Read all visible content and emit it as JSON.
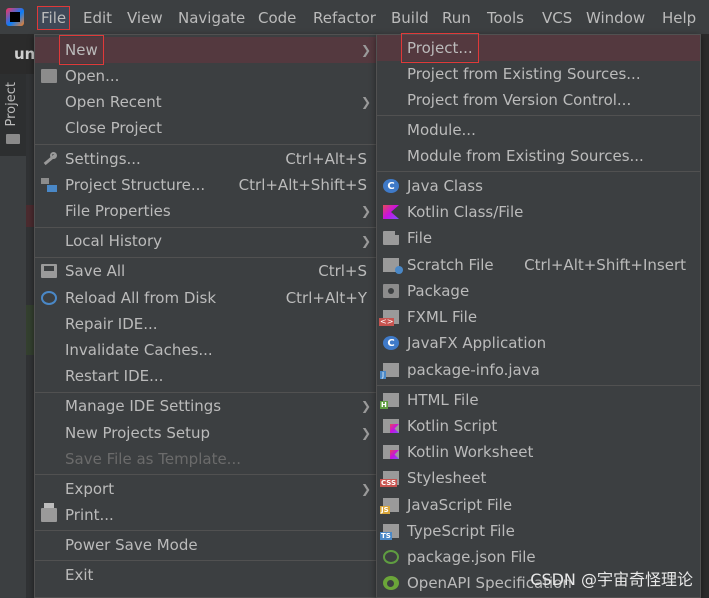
{
  "menubar": {
    "items": [
      "File",
      "Edit",
      "View",
      "Navigate",
      "Code",
      "Refactor",
      "Build",
      "Run",
      "Tools",
      "VCS",
      "Window",
      "Help"
    ]
  },
  "background": {
    "title": "unt",
    "project_tab": "Project"
  },
  "file_menu": {
    "items": [
      {
        "label": "New",
        "arrow": true,
        "selected": true
      },
      {
        "label": "Open...",
        "icon": "folder-icon"
      },
      {
        "label": "Open Recent",
        "arrow": true
      },
      {
        "label": "Close Project"
      },
      {
        "label": "Settings...",
        "shortcut": "Ctrl+Alt+S",
        "icon": "wrench-icon"
      },
      {
        "label": "Project Structure...",
        "shortcut": "Ctrl+Alt+Shift+S",
        "icon": "project-structure-icon"
      },
      {
        "label": "File Properties",
        "arrow": true
      },
      {
        "label": "Local History",
        "arrow": true
      },
      {
        "label": "Save All",
        "shortcut": "Ctrl+S",
        "icon": "save-icon"
      },
      {
        "label": "Reload All from Disk",
        "shortcut": "Ctrl+Alt+Y",
        "icon": "reload-icon"
      },
      {
        "label": "Repair IDE..."
      },
      {
        "label": "Invalidate Caches..."
      },
      {
        "label": "Restart IDE..."
      },
      {
        "label": "Manage IDE Settings",
        "arrow": true
      },
      {
        "label": "New Projects Setup",
        "arrow": true
      },
      {
        "label": "Save File as Template...",
        "disabled": true
      },
      {
        "label": "Export",
        "arrow": true
      },
      {
        "label": "Print...",
        "icon": "printer-icon"
      },
      {
        "label": "Power Save Mode"
      },
      {
        "label": "Exit"
      }
    ]
  },
  "new_menu": {
    "items": [
      {
        "label": "Project...",
        "selected": true
      },
      {
        "label": "Project from Existing Sources..."
      },
      {
        "label": "Project from Version Control..."
      },
      {
        "label": "Module..."
      },
      {
        "label": "Module from Existing Sources..."
      },
      {
        "label": "Java Class",
        "icon": "java-class-icon"
      },
      {
        "label": "Kotlin Class/File",
        "icon": "kotlin-icon"
      },
      {
        "label": "File",
        "icon": "file-icon"
      },
      {
        "label": "Scratch File",
        "shortcut": "Ctrl+Alt+Shift+Insert",
        "icon": "scratch-file-icon"
      },
      {
        "label": "Package",
        "icon": "package-icon"
      },
      {
        "label": "FXML File",
        "icon": "fxml-icon"
      },
      {
        "label": "JavaFX Application",
        "icon": "javafx-class-icon"
      },
      {
        "label": "package-info.java",
        "icon": "package-info-icon"
      },
      {
        "label": "HTML File",
        "icon": "html-file-icon",
        "tag": "H",
        "tag_color": "#5f9d41"
      },
      {
        "label": "Kotlin Script",
        "icon": "kotlin-script-icon"
      },
      {
        "label": "Kotlin Worksheet",
        "icon": "kotlin-worksheet-icon"
      },
      {
        "label": "Stylesheet",
        "icon": "css-file-icon",
        "tag": "CSS",
        "tag_color": "#c75450"
      },
      {
        "label": "JavaScript File",
        "icon": "js-file-icon",
        "tag": "JS",
        "tag_color": "#d8a53a"
      },
      {
        "label": "TypeScript File",
        "icon": "ts-file-icon",
        "tag": "TS",
        "tag_color": "#4a88c7"
      },
      {
        "label": "package.json File",
        "icon": "json-icon"
      },
      {
        "label": "OpenAPI Specification",
        "icon": "openapi-icon"
      }
    ]
  },
  "watermark": "CSDN @宇宙奇怪理论",
  "colors": {
    "menu_bg": "#3c3f41",
    "selection": "#54393f",
    "highlight_outline": "#e03939",
    "text": "#bbbbbb"
  }
}
